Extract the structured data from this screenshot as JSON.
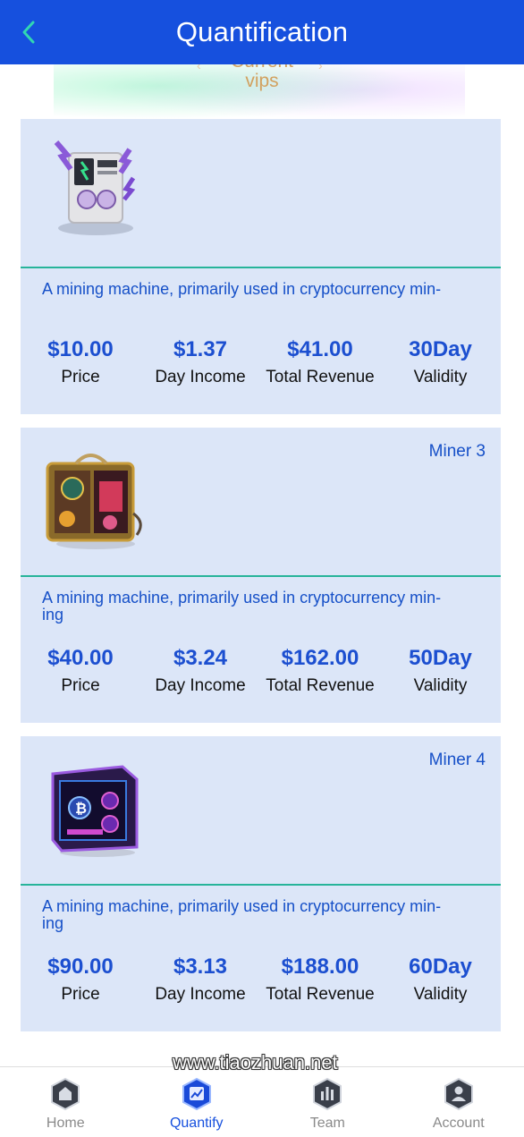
{
  "header": {
    "title": "Quantification"
  },
  "vip_heading": {
    "line1": "Current",
    "line2": "vips"
  },
  "cards": [
    {
      "name": "",
      "description": "A mining machine, primarily used in cryptocurrency min-ing",
      "stats": [
        {
          "value": "$10.00",
          "label": "Price"
        },
        {
          "value": "$1.37",
          "label": "Day Income"
        },
        {
          "value": "$41.00",
          "label": "Total Revenue"
        },
        {
          "value": "30Day",
          "label": "Validity"
        }
      ]
    },
    {
      "name": "Miner 3",
      "description": "A mining machine, primarily used in cryptocurrency min-ing",
      "stats": [
        {
          "value": "$40.00",
          "label": "Price"
        },
        {
          "value": "$3.24",
          "label": "Day Income"
        },
        {
          "value": "$162.00",
          "label": "Total Revenue"
        },
        {
          "value": "50Day",
          "label": "Validity"
        }
      ]
    },
    {
      "name": "Miner 4",
      "description": "A mining machine, primarily used in cryptocurrency min-ing",
      "stats": [
        {
          "value": "$90.00",
          "label": "Price"
        },
        {
          "value": "$3.13",
          "label": "Day Income"
        },
        {
          "value": "$188.00",
          "label": "Total Revenue"
        },
        {
          "value": "60Day",
          "label": "Validity"
        }
      ]
    }
  ],
  "watermark": "www.tiaozhuan.net",
  "tabbar": [
    {
      "label": "Home",
      "icon": "home-icon"
    },
    {
      "label": "Quantify",
      "icon": "quantify-icon",
      "active": true
    },
    {
      "label": "Team",
      "icon": "team-icon"
    },
    {
      "label": "Account",
      "icon": "account-icon"
    }
  ],
  "colors": {
    "primary": "#1650de",
    "card_bg": "#dce6f8",
    "divider": "#27b49a",
    "accent_text": "#d2a15f"
  }
}
